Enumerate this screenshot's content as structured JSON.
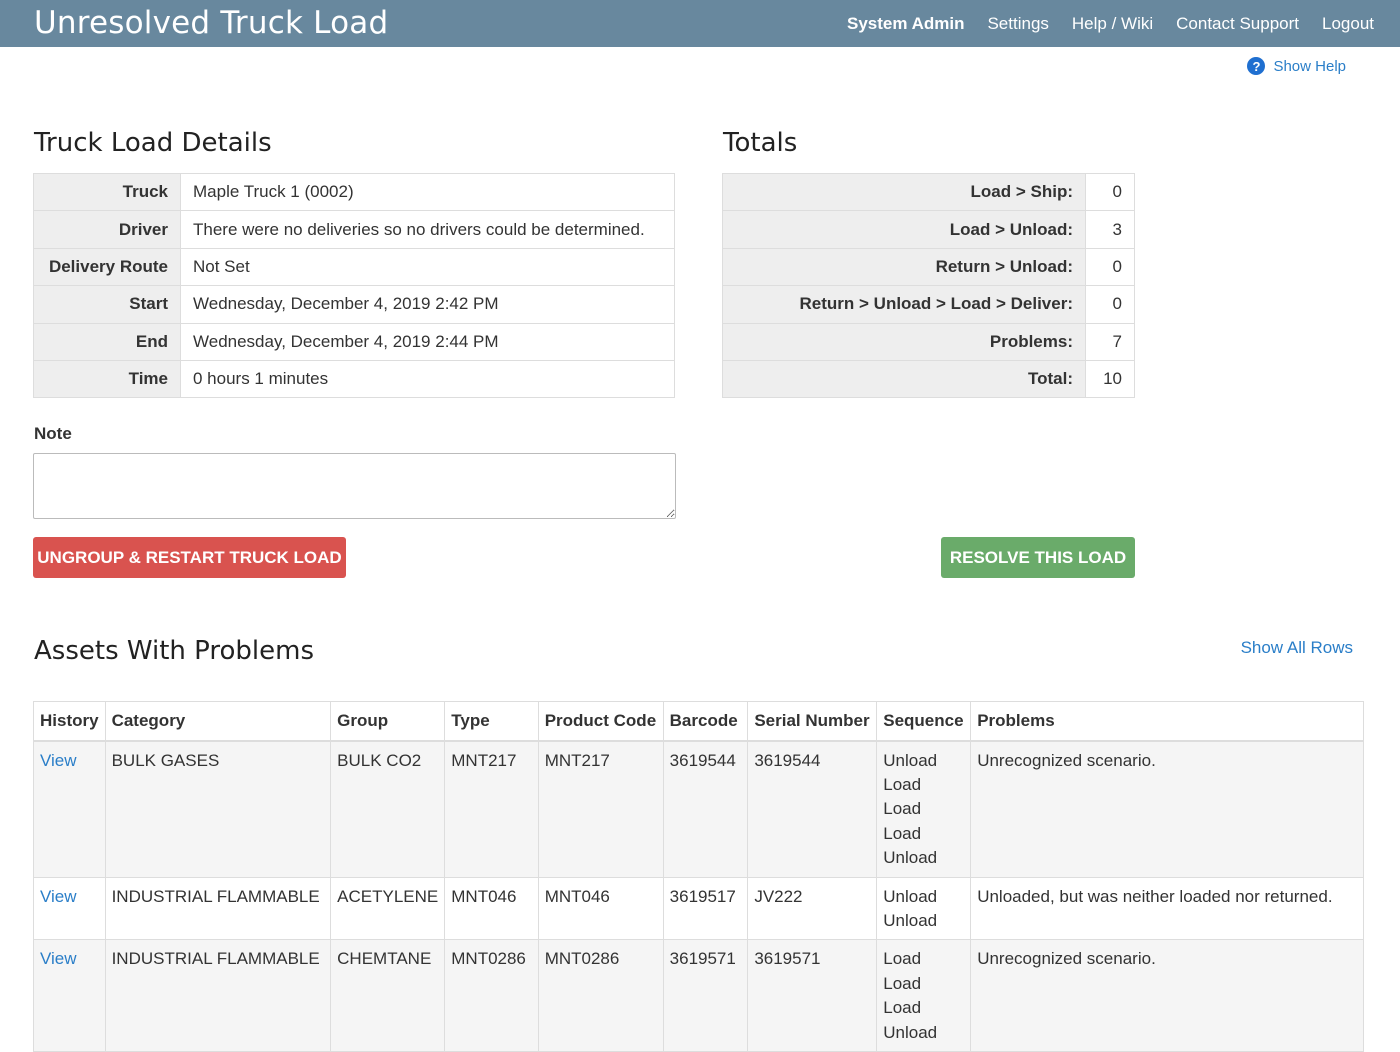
{
  "header": {
    "title": "Unresolved Truck Load",
    "nav": [
      "System Admin",
      "Settings",
      "Help / Wiki",
      "Contact Support",
      "Logout"
    ]
  },
  "help": {
    "label": "Show Help",
    "icon": "question-circle-icon",
    "icon_glyph": "?"
  },
  "details": {
    "title": "Truck Load Details",
    "rows": [
      {
        "label": "Truck",
        "value": "Maple Truck 1 (0002)"
      },
      {
        "label": "Driver",
        "value": "There were no deliveries so no drivers could be determined."
      },
      {
        "label": "Delivery Route",
        "value": "Not Set"
      },
      {
        "label": "Start",
        "value": "Wednesday, December 4, 2019 2:42 PM"
      },
      {
        "label": "End",
        "value": "Wednesday, December 4, 2019 2:44 PM"
      },
      {
        "label": "Time",
        "value": "0 hours 1 minutes"
      }
    ]
  },
  "totals": {
    "title": "Totals",
    "rows": [
      {
        "label": "Load > Ship:",
        "value": "0"
      },
      {
        "label": "Load > Unload:",
        "value": "3"
      },
      {
        "label": "Return > Unload:",
        "value": "0"
      },
      {
        "label": "Return > Unload > Load > Deliver:",
        "value": "0"
      },
      {
        "label": "Problems:",
        "value": "7"
      },
      {
        "label": "Total:",
        "value": "10"
      }
    ]
  },
  "note": {
    "label": "Note",
    "value": ""
  },
  "actions": {
    "ungroup": "UNGROUP & RESTART TRUCK LOAD",
    "resolve": "RESOLVE THIS LOAD"
  },
  "colors": {
    "header": "#68889e",
    "danger": "#d9534f",
    "success": "#6aab6a",
    "link": "#2a7ec8"
  },
  "assets": {
    "title": "Assets With Problems",
    "show_all": "Show All Rows",
    "columns": [
      "History",
      "Category",
      "Group",
      "Type",
      "Product Code",
      "Barcode",
      "Serial Number",
      "Sequence",
      "Problems"
    ],
    "rows": [
      {
        "history": "View",
        "category": "BULK GASES",
        "group": "BULK CO2",
        "type": "MNT217",
        "product_code": "MNT217",
        "barcode": "3619544",
        "serial": "3619544",
        "sequence": [
          "Unload",
          "Load",
          "Load",
          "Load",
          "Unload"
        ],
        "problems": "Unrecognized scenario."
      },
      {
        "history": "View",
        "category": "INDUSTRIAL FLAMMABLE",
        "group": "ACETYLENE",
        "type": "MNT046",
        "product_code": "MNT046",
        "barcode": "3619517",
        "serial": "JV222",
        "sequence": [
          "Unload",
          "Unload"
        ],
        "problems": "Unloaded, but was neither loaded nor returned."
      },
      {
        "history": "View",
        "category": "INDUSTRIAL FLAMMABLE",
        "group": "CHEMTANE",
        "type": "MNT0286",
        "product_code": "MNT0286",
        "barcode": "3619571",
        "serial": "3619571",
        "sequence": [
          "Load",
          "Load",
          "Load",
          "Unload"
        ],
        "problems": "Unrecognized scenario."
      }
    ]
  }
}
